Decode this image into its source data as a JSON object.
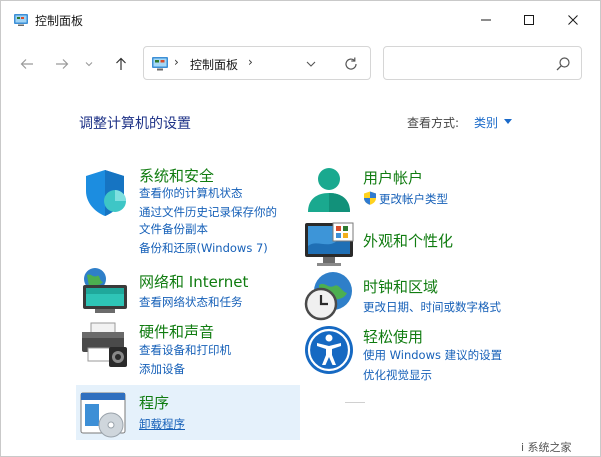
{
  "window": {
    "title": "控制面板"
  },
  "navbar": {
    "address_path": "控制面板",
    "search_placeholder": ""
  },
  "content": {
    "heading": "调整计算机的设置",
    "view_by_label": "查看方式:",
    "view_by_value": "类别"
  },
  "categories": {
    "system_security": {
      "title": "系统和安全",
      "links": [
        "查看你的计算机状态",
        "通过文件历史记录保存你的",
        "文件备份副本",
        "备份和还原(Windows 7)"
      ]
    },
    "network": {
      "title": "网络和 Internet",
      "links": [
        "查看网络状态和任务"
      ]
    },
    "hardware": {
      "title": "硬件和声音",
      "links": [
        "查看设备和打印机",
        "添加设备"
      ]
    },
    "programs": {
      "title": "程序",
      "links": [
        "卸载程序"
      ]
    },
    "user_accounts": {
      "title": "用户帐户",
      "links": [
        "更改帐户类型"
      ]
    },
    "appearance": {
      "title": "外观和个性化",
      "links": []
    },
    "clock_region": {
      "title": "时钟和区域",
      "links": [
        "更改日期、时间或数字格式"
      ]
    },
    "ease_access": {
      "title": "轻松使用",
      "links": [
        "使用 Windows 建议的设置",
        "优化视觉显示"
      ]
    }
  },
  "watermark": "i 系统之家",
  "colors": {
    "category_title": "#107c10",
    "link": "#1660b8",
    "heading": "#1e3287",
    "hover_bg": "#e5f1fb"
  },
  "icons": [
    "control-panel-icon",
    "minimize-icon",
    "maximize-icon",
    "close-icon",
    "back-arrow-icon",
    "forward-arrow-icon",
    "recent-dropdown-icon",
    "up-arrow-icon",
    "refresh-icon",
    "search-icon",
    "shield-icon",
    "globe-network-icon",
    "printer-icon",
    "programs-icon",
    "user-icon",
    "monitor-icon",
    "clock-globe-icon",
    "accessibility-icon",
    "uac-shield-icon"
  ]
}
